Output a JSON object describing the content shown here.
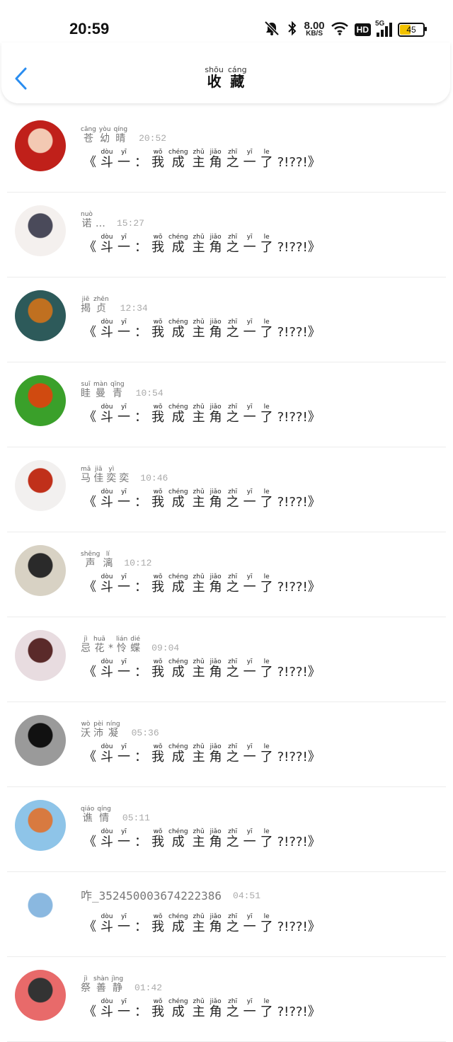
{
  "status": {
    "time": "20:59",
    "net_speed": "8.00",
    "net_unit": "KB/S",
    "hd": "HD",
    "network": "5G",
    "battery": "45"
  },
  "header": {
    "title": [
      {
        "py": "shōu",
        "hz": "收"
      },
      {
        "py": "cáng",
        "hz": "藏"
      }
    ]
  },
  "message": {
    "open": "《",
    "chars": [
      {
        "py": "dòu",
        "hz": "斗"
      },
      {
        "py": "yī",
        "hz": "一"
      },
      {
        "py": "",
        "hz": "："
      },
      {
        "py": "wǒ",
        "hz": "我"
      },
      {
        "py": "chéng",
        "hz": "成"
      },
      {
        "py": "zhǔ",
        "hz": "主"
      },
      {
        "py": "jiǎo",
        "hz": "角"
      },
      {
        "py": "zhī",
        "hz": "之"
      },
      {
        "py": "yī",
        "hz": "一"
      },
      {
        "py": "le",
        "hz": "了"
      }
    ],
    "close": "?!??!》"
  },
  "items": [
    {
      "name": [
        {
          "py": "cāng",
          "hz": "苍"
        },
        {
          "py": "yòu",
          "hz": "幼"
        },
        {
          "py": "qíng",
          "hz": "晴"
        }
      ],
      "time": "20:52",
      "avatar_colors": [
        "#c0201a",
        "#f3c9b3"
      ]
    },
    {
      "name": [
        {
          "py": "nuò",
          "hz": "诺"
        },
        {
          "py": "",
          "hz": "…"
        }
      ],
      "time": "15:27",
      "avatar_colors": [
        "#f4f0ee",
        "#4a4a5a"
      ]
    },
    {
      "name": [
        {
          "py": "jiē",
          "hz": "揭"
        },
        {
          "py": "zhēn",
          "hz": "贞"
        }
      ],
      "time": "12:34",
      "avatar_colors": [
        "#2d5a5a",
        "#c07020"
      ]
    },
    {
      "name": [
        {
          "py": "suī",
          "hz": "眭"
        },
        {
          "py": "màn",
          "hz": "曼"
        },
        {
          "py": "qīng",
          "hz": "青"
        }
      ],
      "time": "10:54",
      "avatar_colors": [
        "#3aa02a",
        "#d04a10"
      ]
    },
    {
      "name": [
        {
          "py": "mǎ",
          "hz": "马"
        },
        {
          "py": "jiā",
          "hz": "佳"
        },
        {
          "py": "yì",
          "hz": "奕"
        },
        {
          "py": "",
          "hz": "奕"
        }
      ],
      "time": "10:46",
      "avatar_colors": [
        "#f2f0ef",
        "#c0301a"
      ]
    },
    {
      "name": [
        {
          "py": "shēng",
          "hz": "声"
        },
        {
          "py": "lí",
          "hz": "漓"
        }
      ],
      "time": "10:12",
      "avatar_colors": [
        "#d8d2c4",
        "#2a2a2a"
      ]
    },
    {
      "name": [
        {
          "py": "jì",
          "hz": "忌"
        },
        {
          "py": "huā",
          "hz": "花"
        },
        {
          "py": "",
          "hz": "*"
        },
        {
          "py": "lián",
          "hz": "怜"
        },
        {
          "py": "dié",
          "hz": "蝶"
        }
      ],
      "time": "09:04",
      "avatar_colors": [
        "#e8dce0",
        "#5a2a2a"
      ]
    },
    {
      "name": [
        {
          "py": "wò",
          "hz": "沃"
        },
        {
          "py": "pèi",
          "hz": "沛"
        },
        {
          "py": "níng",
          "hz": "凝"
        }
      ],
      "time": "05:36",
      "avatar_colors": [
        "#9a9a9a",
        "#111111"
      ]
    },
    {
      "name": [
        {
          "py": "qiáo",
          "hz": "谯"
        },
        {
          "py": "qíng",
          "hz": "情"
        }
      ],
      "time": "05:11",
      "avatar_colors": [
        "#8ec4e8",
        "#d87a40"
      ]
    },
    {
      "name_plain": "咋_352450003674222386",
      "time": "04:51",
      "avatar_colors": [
        "#ffffff",
        "#8ab8e0"
      ]
    },
    {
      "name": [
        {
          "py": "jì",
          "hz": "祭"
        },
        {
          "py": "shàn",
          "hz": "善"
        },
        {
          "py": "jìng",
          "hz": "静"
        }
      ],
      "time": "01:42",
      "avatar_colors": [
        "#e86a6a",
        "#333333"
      ]
    }
  ]
}
